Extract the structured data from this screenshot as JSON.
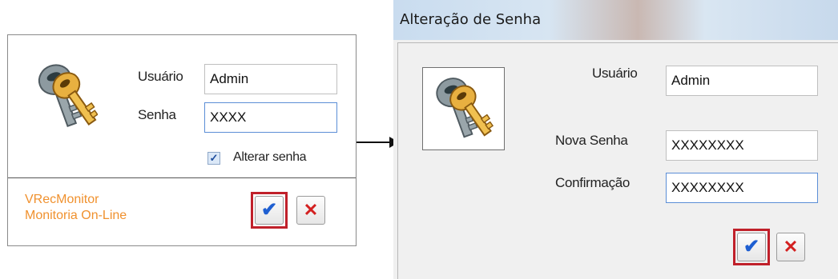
{
  "login": {
    "user_label": "Usuário",
    "user_value": "Admin",
    "password_label": "Senha",
    "password_value": "XXXX",
    "change_password_checked": true,
    "change_password_label": "Alterar senha",
    "brand_line1": "VRecMonitor",
    "brand_line2": "Monitoria On-Line",
    "ok_glyph": "✔",
    "cancel_glyph": "✕",
    "brand_color": "#f0912e",
    "highlight_color": "#c0202a"
  },
  "dialog": {
    "title": "Alteração de Senha",
    "user_label": "Usuário",
    "user_value": "Admin",
    "new_password_label": "Nova Senha",
    "new_password_value": "XXXXXXXX",
    "confirm_label": "Confirmação",
    "confirm_value": "XXXXXXXX",
    "ok_glyph": "✔",
    "cancel_glyph": "✕"
  },
  "icons": {
    "keys": "keys-icon",
    "arrow": "arrow-right-icon"
  }
}
